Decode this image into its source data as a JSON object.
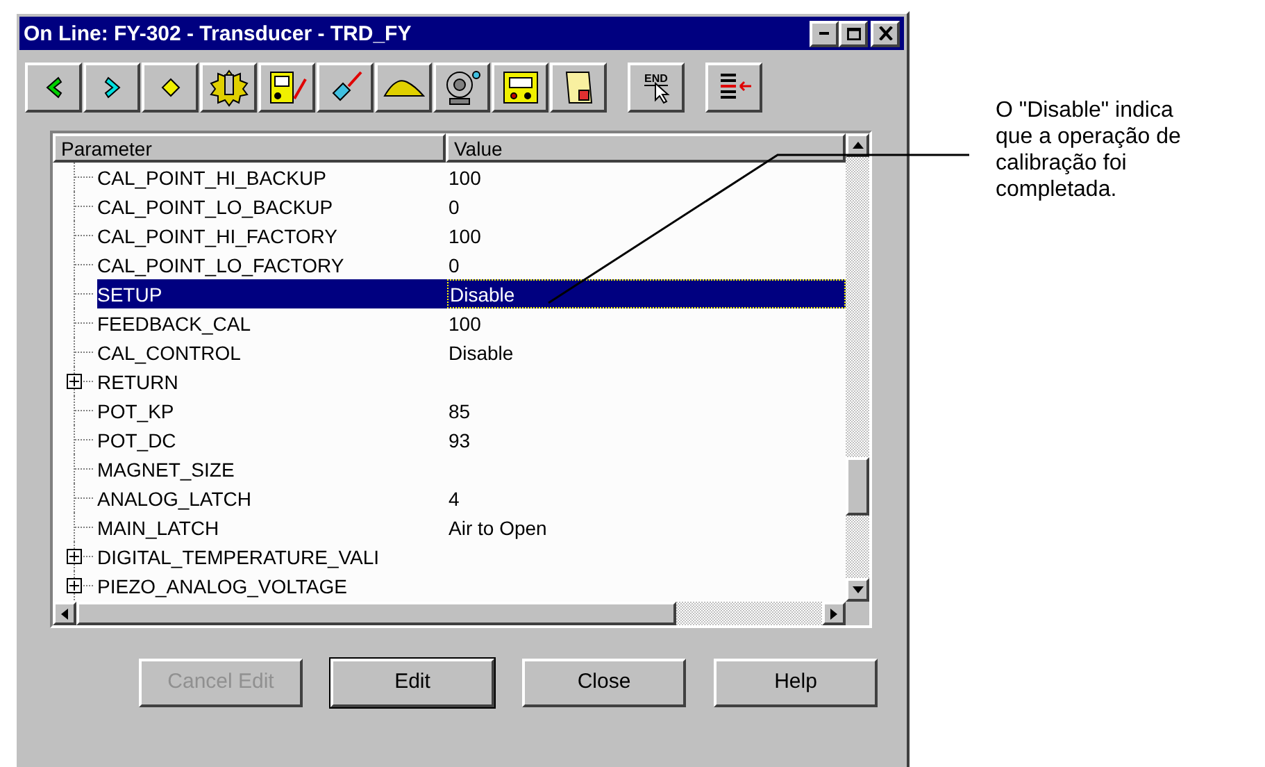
{
  "window": {
    "title": "On Line: FY-302 - Transducer - TRD_FY"
  },
  "toolbar": [
    {
      "kind": "back"
    },
    {
      "kind": "forward"
    },
    {
      "kind": "diamond"
    },
    {
      "kind": "gear"
    },
    {
      "kind": "meter"
    },
    {
      "kind": "tool"
    },
    {
      "kind": "mound"
    },
    {
      "kind": "bell"
    },
    {
      "kind": "device"
    },
    {
      "kind": "scroll"
    },
    {
      "kind": "end",
      "label": "END"
    },
    {
      "kind": "list"
    }
  ],
  "table": {
    "columns": [
      "Parameter",
      "Value"
    ],
    "rows": [
      {
        "kind": "leaf",
        "name": "CAL_POINT_HI_BACKUP",
        "value": "100",
        "selected": false
      },
      {
        "kind": "leaf",
        "name": "CAL_POINT_LO_BACKUP",
        "value": "0",
        "selected": false
      },
      {
        "kind": "leaf",
        "name": "CAL_POINT_HI_FACTORY",
        "value": "100",
        "selected": false
      },
      {
        "kind": "leaf",
        "name": "CAL_POINT_LO_FACTORY",
        "value": "0",
        "selected": false
      },
      {
        "kind": "leaf",
        "name": "SETUP",
        "value": "Disable",
        "selected": true
      },
      {
        "kind": "leaf",
        "name": "FEEDBACK_CAL",
        "value": "100",
        "selected": false
      },
      {
        "kind": "leaf",
        "name": "CAL_CONTROL",
        "value": "Disable",
        "selected": false
      },
      {
        "kind": "group",
        "name": "RETURN",
        "expanded": false,
        "selected": false
      },
      {
        "kind": "leaf",
        "name": "POT_KP",
        "value": "85",
        "selected": false
      },
      {
        "kind": "leaf",
        "name": "POT_DC",
        "value": "93",
        "selected": false
      },
      {
        "kind": "leaf",
        "name": "MAGNET_SIZE",
        "selected": false
      },
      {
        "kind": "leaf",
        "name": "ANALOG_LATCH",
        "value": "4",
        "selected": false
      },
      {
        "kind": "leaf",
        "name": "MAIN_LATCH",
        "value": "Air to Open",
        "selected": false
      },
      {
        "kind": "group",
        "name": "DIGITAL_TEMPERATURE_VALI",
        "expanded": false,
        "selected": false
      },
      {
        "kind": "group",
        "name": "PIEZO_ANALOG_VOLTAGE",
        "expanded": false,
        "selected": false
      }
    ]
  },
  "buttons": [
    {
      "label": "Cancel Edit",
      "disabled": true,
      "default": false
    },
    {
      "label": "Edit",
      "disabled": false,
      "default": true
    },
    {
      "label": "Close",
      "disabled": false,
      "default": false
    },
    {
      "label": "Help",
      "disabled": false,
      "default": false
    }
  ],
  "annotation": {
    "text": "O \"Disable\" indica\nque a operação de\ncalibração foi\ncompletada."
  }
}
